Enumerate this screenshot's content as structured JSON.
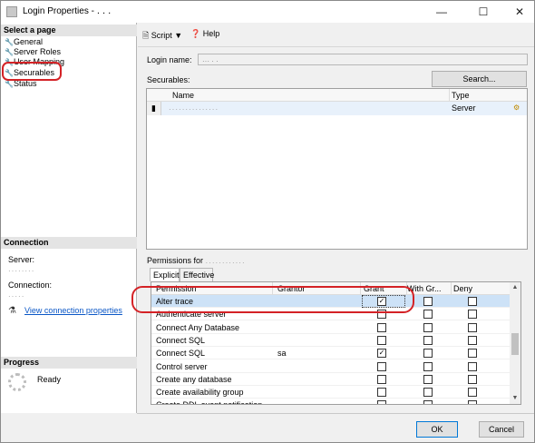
{
  "window": {
    "title": "Login Properties - ․ ․ ․"
  },
  "left_pane": {
    "select_page_header": "Select a page",
    "pages": [
      {
        "label": "General",
        "icon": "wrench-icon",
        "selected": false
      },
      {
        "label": "Server Roles",
        "icon": "wrench-icon",
        "selected": false
      },
      {
        "label": "User Mapping",
        "icon": "wrench-icon",
        "selected": false
      },
      {
        "label": "Securables",
        "icon": "wrench-icon",
        "selected": true
      },
      {
        "label": "Status",
        "icon": "wrench-icon",
        "selected": false
      }
    ],
    "connection_header": "Connection",
    "server_label": "Server:",
    "server_value": "․․․․․․․․",
    "connection_label": "Connection:",
    "connection_value": "․․․․․",
    "view_link": "View connection properties",
    "progress_header": "Progress",
    "progress_status": "Ready"
  },
  "toolbar": {
    "script_label": "Script",
    "help_label": "Help"
  },
  "main": {
    "login_name_label": "Login name:",
    "login_name_value": "․․․ ․ ․",
    "securables_label": "Securables:",
    "search_button": "Search...",
    "securables_columns": [
      "Name",
      "Type"
    ],
    "securables_rows": [
      {
        "name": "․․․․․․․․․․․․․․․",
        "type": "Server"
      }
    ],
    "permissions_for_label": "Permissions for",
    "permissions_for_value": "․․․․․․․․․․․․",
    "tabs": [
      "Explicit",
      "Effective"
    ],
    "permission_columns": [
      "Permission",
      "Grantor",
      "Grant",
      "With Gr...",
      "Deny"
    ],
    "permissions": [
      {
        "name": "Alter trace",
        "grantor": "",
        "grant": true,
        "with_grant": false,
        "deny": false,
        "selected": true
      },
      {
        "name": "Authenticate server",
        "grantor": "",
        "grant": false,
        "with_grant": false,
        "deny": false
      },
      {
        "name": "Connect Any Database",
        "grantor": "",
        "grant": false,
        "with_grant": false,
        "deny": false
      },
      {
        "name": "Connect SQL",
        "grantor": "",
        "grant": false,
        "with_grant": false,
        "deny": false
      },
      {
        "name": "Connect SQL",
        "grantor": "sa",
        "grant": true,
        "with_grant": false,
        "deny": false
      },
      {
        "name": "Control server",
        "grantor": "",
        "grant": false,
        "with_grant": false,
        "deny": false
      },
      {
        "name": "Create any database",
        "grantor": "",
        "grant": false,
        "with_grant": false,
        "deny": false
      },
      {
        "name": "Create availability group",
        "grantor": "",
        "grant": false,
        "with_grant": false,
        "deny": false
      },
      {
        "name": "Create DDL event notification",
        "grantor": "",
        "grant": false,
        "with_grant": false,
        "deny": false
      }
    ]
  },
  "footer": {
    "ok_label": "OK",
    "cancel_label": "Cancel"
  },
  "colors": {
    "highlight_red": "#d42226",
    "link_blue": "#0b57c6",
    "selection_blue": "#cde2f7"
  }
}
